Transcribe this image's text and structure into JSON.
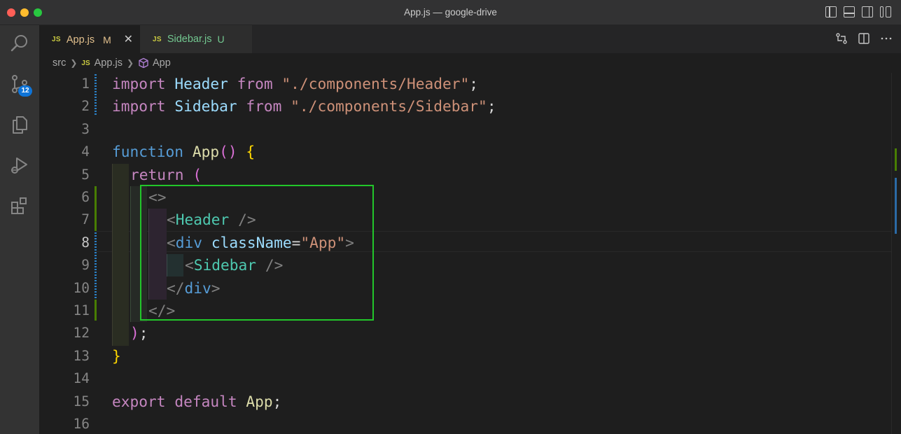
{
  "window": {
    "title": "App.js — google-drive"
  },
  "activity": {
    "scm_badge": "12"
  },
  "tabs": [
    {
      "name": "App.js",
      "status": "M",
      "badge": "JS"
    },
    {
      "name": "Sidebar.js",
      "status": "U",
      "badge": "JS"
    }
  ],
  "breadcrumb": {
    "folder": "src",
    "file": "App.js",
    "file_badge": "JS",
    "symbol": "App"
  },
  "editor": {
    "line_numbers": [
      "1",
      "2",
      "3",
      "4",
      "5",
      "6",
      "7",
      "8",
      "9",
      "10",
      "11",
      "12",
      "13",
      "14",
      "15",
      "16"
    ],
    "active_line": "8"
  },
  "code": {
    "l1": {
      "kw": "import",
      "name": "Header",
      "from": "from",
      "path": "\"./components/Header\"",
      "end": ";"
    },
    "l2": {
      "kw": "import",
      "name": "Sidebar",
      "from": "from",
      "path": "\"./components/Sidebar\"",
      "end": ";"
    },
    "l4": {
      "kw": "function",
      "name": "App",
      "parens": "()",
      "brace": "{"
    },
    "l5": {
      "kw": "return",
      "paren": "("
    },
    "l6": {
      "frag_open": "<>"
    },
    "l7": {
      "lt": "<",
      "tag": "Header",
      "close": " />"
    },
    "l8": {
      "lt": "<",
      "tag": "div",
      "attr": "className",
      "eq": "=",
      "val": "\"App\"",
      "gt": ">"
    },
    "l9": {
      "lt": "<",
      "tag": "Sidebar",
      "close": " />"
    },
    "l10": {
      "lt": "</",
      "tag": "div",
      "gt": ">"
    },
    "l11": {
      "frag_close": "</>"
    },
    "l12": {
      "paren": ")",
      "end": ";"
    },
    "l13": {
      "brace": "}"
    },
    "l15": {
      "kw1": "export",
      "kw2": "default",
      "name": "App",
      "end": ";"
    }
  },
  "colors": {
    "highlight_box": "#22c62a",
    "modified": "#e2c08d",
    "untracked": "#73c991",
    "badge": "#0e74d8"
  }
}
